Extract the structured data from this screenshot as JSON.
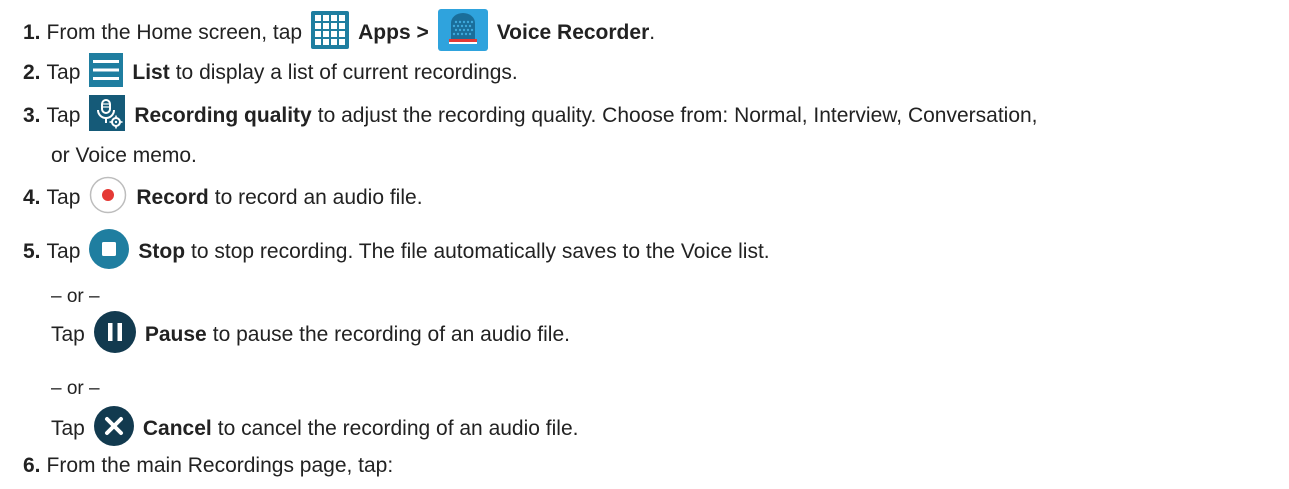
{
  "steps": [
    {
      "number": "1.",
      "pre": "From the Home screen, tap",
      "apps_label": "Apps >",
      "voice_recorder_label": "Voice Recorder",
      "end": ".",
      "icons": [
        "apps-grid-icon",
        "voice-recorder-app-icon"
      ]
    },
    {
      "number": "2.",
      "pre": "Tap",
      "bold": "List",
      "post": "to display a list of current recordings.",
      "icon": "list-icon"
    },
    {
      "number": "3.",
      "pre": "Tap",
      "bold": "Recording quality",
      "post": "to adjust the recording quality. Choose from: Normal, Interview, Conversation,",
      "continuation": "or Voice memo.",
      "icon": "recording-quality-icon"
    },
    {
      "number": "4.",
      "pre": "Tap",
      "bold": "Record",
      "post": "to record an audio file.",
      "icon": "record-icon"
    },
    {
      "number": "5.",
      "pre": "Tap",
      "bold": "Stop",
      "post": "to stop recording. The file automatically saves to the Voice list.",
      "icon": "stop-icon",
      "or1": "– or –",
      "alt1": {
        "pre": "Tap",
        "bold": "Pause",
        "post": "to pause the recording of an audio file.",
        "icon": "pause-icon"
      },
      "or2": "– or –",
      "alt2": {
        "pre": "Tap",
        "bold": "Cancel",
        "post": "to cancel the recording of an audio file.",
        "icon": "cancel-icon"
      }
    },
    {
      "number": "6.",
      "text": "From the main Recordings page, tap:"
    }
  ],
  "colors": {
    "text": "#222222",
    "icon_teal": "#1f7ea0",
    "icon_light_blue": "#2fa3dd",
    "icon_dark_navy": "#123a4f",
    "record_red": "#e53935"
  }
}
